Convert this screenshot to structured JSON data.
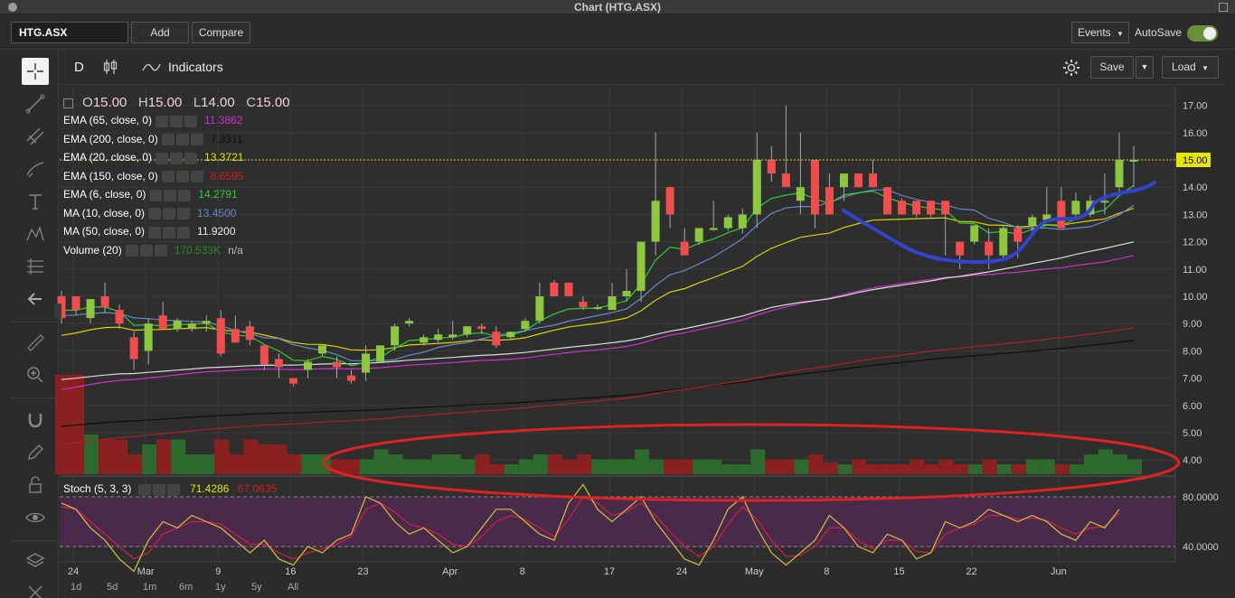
{
  "window": {
    "title": "Chart (HTG.ASX)"
  },
  "toolbar": {
    "symbol": "HTG.ASX",
    "add_label": "Add",
    "compare_label": "Compare",
    "events_label": "Events",
    "autosave_label": "AutoSave",
    "autosave_on": true
  },
  "chart_toolbar": {
    "period": "D",
    "indicators_label": "Indicators",
    "save_label": "Save",
    "load_label": "Load"
  },
  "legend": {
    "ohlc": {
      "o_label": "O",
      "o": "15.00",
      "h_label": "H",
      "h": "15.00",
      "l_label": "L",
      "l": "14.00",
      "c_label": "C",
      "c": "15.00"
    },
    "indicators": [
      {
        "name": "EMA (65, close, 0)",
        "value": "11.3862",
        "color": "#cc33cc"
      },
      {
        "name": "EMA (200, close, 0)",
        "value": "7.3311",
        "color": "#111111"
      },
      {
        "name": "EMA (20, close, 0)",
        "value": "13.3721",
        "color": "#e6e600"
      },
      {
        "name": "EMA (150, close, 0)",
        "value": "8.6595",
        "color": "#cc2222"
      },
      {
        "name": "EMA (6, close, 0)",
        "value": "14.2791",
        "color": "#33cc33"
      },
      {
        "name": "MA (10, close, 0)",
        "value": "13.4500",
        "color": "#6688cc"
      },
      {
        "name": "MA (50, close, 0)",
        "value": "11.9200",
        "color": "#eeeeee"
      },
      {
        "name": "Volume (20)",
        "value": "170.533K",
        "value2": "n/a",
        "color": "#2d8a2d"
      }
    ],
    "stoch": {
      "name": "Stoch (5, 3, 3)",
      "k": "71.4286",
      "d": "67.0635",
      "k_color": "#e6e600",
      "d_color": "#cc2222"
    }
  },
  "colors": {
    "up": "#8dc63f",
    "down": "#f04e4e",
    "vol_up": "#2d6a2d",
    "vol_down": "#8b2020",
    "grid": "#3a3a3a",
    "stoch_band": "#4a2a4a",
    "annotation_blue": "#3344cc",
    "annotation_red": "#dd2222",
    "last_price_bg": "#e6e600"
  },
  "chart_data": {
    "type": "candlestick",
    "y_ticks": [
      "17.00",
      "16.00",
      "15.00",
      "14.00",
      "13.00",
      "12.00",
      "11.00",
      "10.00",
      "9.00",
      "8.00",
      "7.00",
      "6.00",
      "5.00",
      "4.00"
    ],
    "last_price": "15.00",
    "stoch_ticks": [
      "80.0000",
      "40.0000"
    ],
    "x_labels": [
      "24",
      "Mar",
      "9",
      "16",
      "23",
      "Apr",
      "8",
      "17",
      "24",
      "May",
      "8",
      "15",
      "22",
      "Jun"
    ],
    "candles": [
      {
        "o": 10.0,
        "h": 10.2,
        "l": 9.0,
        "c": 9.2
      },
      {
        "o": 10.0,
        "h": 10.0,
        "l": 9.3,
        "c": 9.5
      },
      {
        "o": 9.2,
        "h": 9.8,
        "l": 9.0,
        "c": 9.9
      },
      {
        "o": 10.0,
        "h": 10.5,
        "l": 9.4,
        "c": 9.6
      },
      {
        "o": 9.5,
        "h": 9.7,
        "l": 8.8,
        "c": 9.0
      },
      {
        "o": 8.5,
        "h": 8.7,
        "l": 7.3,
        "c": 7.7
      },
      {
        "o": 8.0,
        "h": 9.2,
        "l": 7.5,
        "c": 9.0
      },
      {
        "o": 9.3,
        "h": 9.8,
        "l": 8.8,
        "c": 8.8
      },
      {
        "o": 8.8,
        "h": 9.2,
        "l": 8.7,
        "c": 9.1
      },
      {
        "o": 8.8,
        "h": 9.1,
        "l": 8.7,
        "c": 9.0
      },
      {
        "o": 9.0,
        "h": 9.3,
        "l": 8.7,
        "c": 9.1
      },
      {
        "o": 9.2,
        "h": 9.5,
        "l": 7.8,
        "c": 7.9
      },
      {
        "o": 8.8,
        "h": 9.3,
        "l": 8.3,
        "c": 8.3
      },
      {
        "o": 8.9,
        "h": 9.1,
        "l": 8.2,
        "c": 8.4
      },
      {
        "o": 8.2,
        "h": 8.2,
        "l": 7.3,
        "c": 7.5
      },
      {
        "o": 7.7,
        "h": 7.9,
        "l": 7.0,
        "c": 7.4
      },
      {
        "o": 7.0,
        "h": 7.0,
        "l": 6.7,
        "c": 6.8
      },
      {
        "o": 7.3,
        "h": 7.7,
        "l": 7.0,
        "c": 7.6
      },
      {
        "o": 7.9,
        "h": 8.1,
        "l": 7.8,
        "c": 8.2
      },
      {
        "o": 7.6,
        "h": 7.8,
        "l": 7.0,
        "c": 7.4
      },
      {
        "o": 7.1,
        "h": 7.3,
        "l": 6.8,
        "c": 6.9
      },
      {
        "o": 7.2,
        "h": 8.2,
        "l": 6.9,
        "c": 7.9
      },
      {
        "o": 7.6,
        "h": 8.2,
        "l": 7.6,
        "c": 8.2
      },
      {
        "o": 8.2,
        "h": 9.0,
        "l": 8.0,
        "c": 8.9
      },
      {
        "o": 9.0,
        "h": 9.2,
        "l": 8.9,
        "c": 9.1
      },
      {
        "o": 8.3,
        "h": 8.6,
        "l": 8.2,
        "c": 8.5
      },
      {
        "o": 8.4,
        "h": 8.8,
        "l": 8.3,
        "c": 8.6
      },
      {
        "o": 8.5,
        "h": 9.1,
        "l": 8.4,
        "c": 8.6
      },
      {
        "o": 8.6,
        "h": 8.9,
        "l": 8.5,
        "c": 8.9
      },
      {
        "o": 8.9,
        "h": 9.0,
        "l": 8.6,
        "c": 8.8
      },
      {
        "o": 8.7,
        "h": 8.9,
        "l": 8.1,
        "c": 8.2
      },
      {
        "o": 8.5,
        "h": 8.7,
        "l": 8.4,
        "c": 8.7
      },
      {
        "o": 8.8,
        "h": 9.2,
        "l": 8.7,
        "c": 9.1
      },
      {
        "o": 9.1,
        "h": 10.5,
        "l": 9.0,
        "c": 10.0
      },
      {
        "o": 10.5,
        "h": 10.6,
        "l": 10.0,
        "c": 10.0
      },
      {
        "o": 10.5,
        "h": 10.5,
        "l": 10.0,
        "c": 10.0
      },
      {
        "o": 9.8,
        "h": 10.0,
        "l": 9.5,
        "c": 9.6
      },
      {
        "o": 9.6,
        "h": 9.7,
        "l": 9.5,
        "c": 9.6
      },
      {
        "o": 9.5,
        "h": 10.5,
        "l": 9.5,
        "c": 10.0
      },
      {
        "o": 10.0,
        "h": 11.0,
        "l": 9.8,
        "c": 10.2
      },
      {
        "o": 10.2,
        "h": 12.0,
        "l": 9.8,
        "c": 12.0
      },
      {
        "o": 12.0,
        "h": 16.0,
        "l": 11.5,
        "c": 13.5
      },
      {
        "o": 14.0,
        "h": 14.0,
        "l": 12.5,
        "c": 13.0
      },
      {
        "o": 12.0,
        "h": 12.5,
        "l": 11.8,
        "c": 11.5
      },
      {
        "o": 12.0,
        "h": 12.5,
        "l": 11.9,
        "c": 12.5
      },
      {
        "o": 12.5,
        "h": 13.5,
        "l": 12.4,
        "c": 12.5
      },
      {
        "o": 12.5,
        "h": 13.0,
        "l": 12.4,
        "c": 12.9
      },
      {
        "o": 12.5,
        "h": 13.2,
        "l": 12.3,
        "c": 13.0
      },
      {
        "o": 13.0,
        "h": 16.0,
        "l": 12.5,
        "c": 15.0
      },
      {
        "o": 15.0,
        "h": 15.5,
        "l": 14.2,
        "c": 14.5
      },
      {
        "o": 14.5,
        "h": 17.0,
        "l": 14.0,
        "c": 14.0
      },
      {
        "o": 13.5,
        "h": 16.0,
        "l": 13.0,
        "c": 14.0
      },
      {
        "o": 15.0,
        "h": 15.0,
        "l": 12.5,
        "c": 13.0
      },
      {
        "o": 14.0,
        "h": 14.5,
        "l": 13.0,
        "c": 13.0
      },
      {
        "o": 14.0,
        "h": 14.5,
        "l": 13.5,
        "c": 14.5
      },
      {
        "o": 14.5,
        "h": 14.5,
        "l": 14.0,
        "c": 14.0
      },
      {
        "o": 14.5,
        "h": 15.0,
        "l": 14.0,
        "c": 14.0
      },
      {
        "o": 14.0,
        "h": 14.0,
        "l": 13.0,
        "c": 13.0
      },
      {
        "o": 13.5,
        "h": 13.6,
        "l": 13.0,
        "c": 13.0
      },
      {
        "o": 13.5,
        "h": 13.5,
        "l": 12.9,
        "c": 13.0
      },
      {
        "o": 13.5,
        "h": 13.5,
        "l": 12.9,
        "c": 13.0
      },
      {
        "o": 13.5,
        "h": 13.5,
        "l": 11.5,
        "c": 13.0
      },
      {
        "o": 12.0,
        "h": 12.0,
        "l": 11.0,
        "c": 11.5
      },
      {
        "o": 12.0,
        "h": 12.6,
        "l": 11.9,
        "c": 12.6
      },
      {
        "o": 12.0,
        "h": 12.5,
        "l": 11.0,
        "c": 11.5
      },
      {
        "o": 11.5,
        "h": 12.6,
        "l": 11.3,
        "c": 12.5
      },
      {
        "o": 12.5,
        "h": 12.6,
        "l": 11.4,
        "c": 12.0
      },
      {
        "o": 12.6,
        "h": 13.0,
        "l": 12.4,
        "c": 12.9
      },
      {
        "o": 12.8,
        "h": 14.0,
        "l": 12.8,
        "c": 13.0
      },
      {
        "o": 13.5,
        "h": 14.0,
        "l": 12.5,
        "c": 12.5
      },
      {
        "o": 13.0,
        "h": 13.8,
        "l": 12.8,
        "c": 13.5
      },
      {
        "o": 13.0,
        "h": 13.7,
        "l": 12.9,
        "c": 13.5
      },
      {
        "o": 13.5,
        "h": 14.5,
        "l": 13.0,
        "c": 13.5
      },
      {
        "o": 14.0,
        "h": 16.0,
        "l": 13.8,
        "c": 15.0
      },
      {
        "o": 15.0,
        "h": 15.5,
        "l": 14.0,
        "c": 15.0
      }
    ],
    "stoch_k": [
      75,
      70,
      55,
      45,
      30,
      20,
      45,
      60,
      55,
      65,
      60,
      55,
      45,
      35,
      45,
      30,
      25,
      40,
      35,
      45,
      50,
      80,
      75,
      60,
      50,
      55,
      45,
      35,
      40,
      55,
      70,
      70,
      60,
      50,
      45,
      75,
      90,
      70,
      60,
      70,
      80,
      60,
      45,
      30,
      25,
      45,
      70,
      80,
      55,
      35,
      25,
      35,
      45,
      65,
      55,
      40,
      35,
      50,
      45,
      30,
      35,
      60,
      55,
      60,
      70,
      65,
      60,
      65,
      60,
      50,
      45,
      60,
      55,
      70
    ],
    "stoch_d": [
      72,
      70,
      60,
      50,
      40,
      30,
      35,
      50,
      55,
      60,
      60,
      58,
      50,
      42,
      42,
      35,
      30,
      35,
      38,
      42,
      48,
      70,
      75,
      68,
      58,
      55,
      50,
      42,
      40,
      48,
      60,
      65,
      62,
      55,
      48,
      62,
      80,
      75,
      65,
      68,
      75,
      65,
      52,
      40,
      32,
      40,
      58,
      72,
      62,
      45,
      32,
      33,
      40,
      55,
      55,
      45,
      38,
      45,
      45,
      36,
      35,
      50,
      55,
      58,
      65,
      65,
      62,
      63,
      61,
      55,
      50,
      55,
      56,
      67
    ],
    "volume": [
      1.0,
      1.0,
      0.4,
      0.35,
      0.35,
      0.2,
      0.3,
      0.35,
      0.35,
      0.2,
      0.2,
      0.35,
      0.2,
      0.35,
      0.3,
      0.3,
      0.2,
      0.2,
      0.2,
      0.15,
      0.15,
      0.15,
      0.25,
      0.2,
      0.15,
      0.15,
      0.2,
      0.2,
      0.15,
      0.2,
      0.1,
      0.1,
      0.15,
      0.2,
      0.2,
      0.15,
      0.2,
      0.15,
      0.15,
      0.15,
      0.25,
      0.15,
      0.15,
      0.15,
      0.15,
      0.15,
      0.1,
      0.1,
      0.25,
      0.15,
      0.15,
      0.15,
      0.2,
      0.12,
      0.1,
      0.15,
      0.1,
      0.1,
      0.1,
      0.15,
      0.1,
      0.15,
      0.1,
      0.1,
      0.15,
      0.1,
      0.1,
      0.15,
      0.15,
      0.1,
      0.1,
      0.2,
      0.25,
      0.2,
      0.15
    ]
  },
  "timeframes": [
    "1d",
    "5d",
    "1m",
    "6m",
    "1y",
    "5y",
    "All"
  ]
}
